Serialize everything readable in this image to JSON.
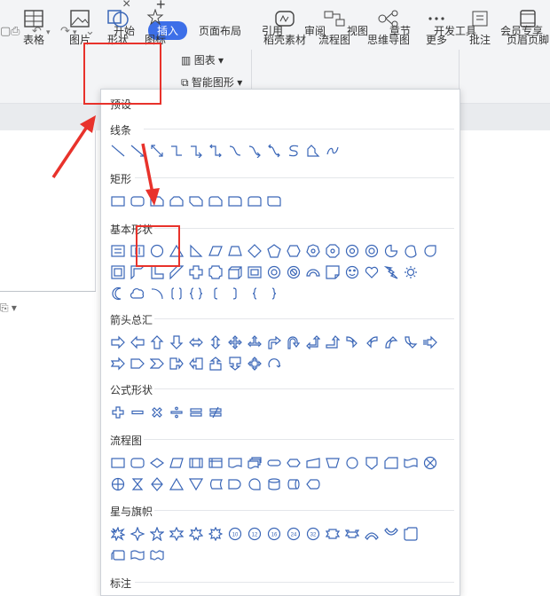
{
  "tabbar": {
    "close_glyph": "×",
    "add_glyph": "+"
  },
  "quick_access": [
    "undo-icon",
    "redo-icon",
    "more-icon"
  ],
  "menu": {
    "items": [
      {
        "label": "开始",
        "active": false
      },
      {
        "label": "插入",
        "active": true
      },
      {
        "label": "页面布局",
        "active": false
      },
      {
        "label": "引用",
        "active": false
      },
      {
        "label": "审阅",
        "active": false
      },
      {
        "label": "视图",
        "active": false
      },
      {
        "label": "章节",
        "active": false
      },
      {
        "label": "开发工具",
        "active": false
      },
      {
        "label": "会员专享",
        "active": false
      }
    ],
    "accent": "#3d6fe8"
  },
  "ribbon": {
    "table": "表格",
    "picture": "图片",
    "shape": "形状",
    "icon": "图标",
    "chart": "图表",
    "smartart": "智能图形",
    "straw": "稻壳素材",
    "flowchart": "流程图",
    "mindmap": "思维导图",
    "more": "更多",
    "comment": "批注",
    "header": "页眉页脚"
  },
  "shape_panel": {
    "sections": [
      {
        "title": "预设"
      },
      {
        "title": "线条"
      },
      {
        "title": "矩形"
      },
      {
        "title": "基本形状"
      },
      {
        "title": "箭头总汇"
      },
      {
        "title": "公式形状"
      },
      {
        "title": "流程图"
      },
      {
        "title": "星与旗帜"
      },
      {
        "title": "标注"
      }
    ]
  },
  "highlight_color": "#e8322b"
}
